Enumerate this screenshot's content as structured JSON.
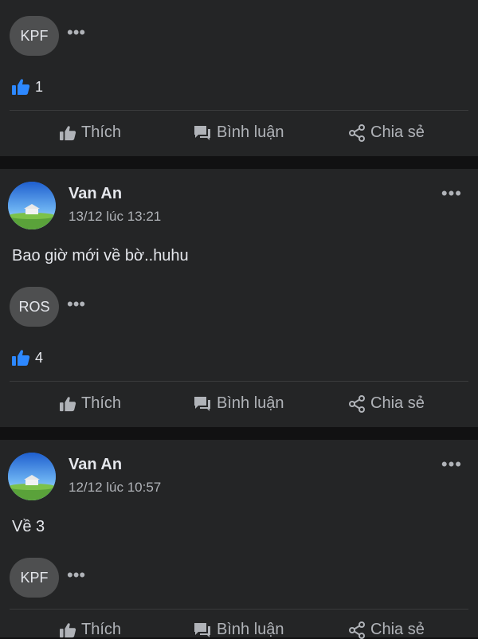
{
  "card1": {
    "reaction_pill": "KPF",
    "like_count": "1",
    "actions": {
      "like": "Thích",
      "comment": "Bình luận",
      "share": "Chia sẻ"
    }
  },
  "card2": {
    "author": "Van An",
    "timestamp": "13/12 lúc 13:21",
    "text": "Bao giờ mới về bờ..huhu",
    "reaction_pill": "ROS",
    "like_count": "4",
    "actions": {
      "like": "Thích",
      "comment": "Bình luận",
      "share": "Chia sẻ"
    }
  },
  "card3": {
    "author": "Van An",
    "timestamp": "12/12 lúc 10:57",
    "text": "Về 3",
    "reaction_pill": "KPF",
    "actions": {
      "like": "Thích",
      "comment": "Bình luận",
      "share": "Chia sẻ"
    }
  },
  "colors": {
    "background": "#111112",
    "card": "#242526",
    "like_blue": "#2d88ff",
    "muted_text": "#b0b3b8"
  },
  "icons": [
    "thumbs-up-icon",
    "comment-icon",
    "share-icon",
    "more-icon"
  ]
}
